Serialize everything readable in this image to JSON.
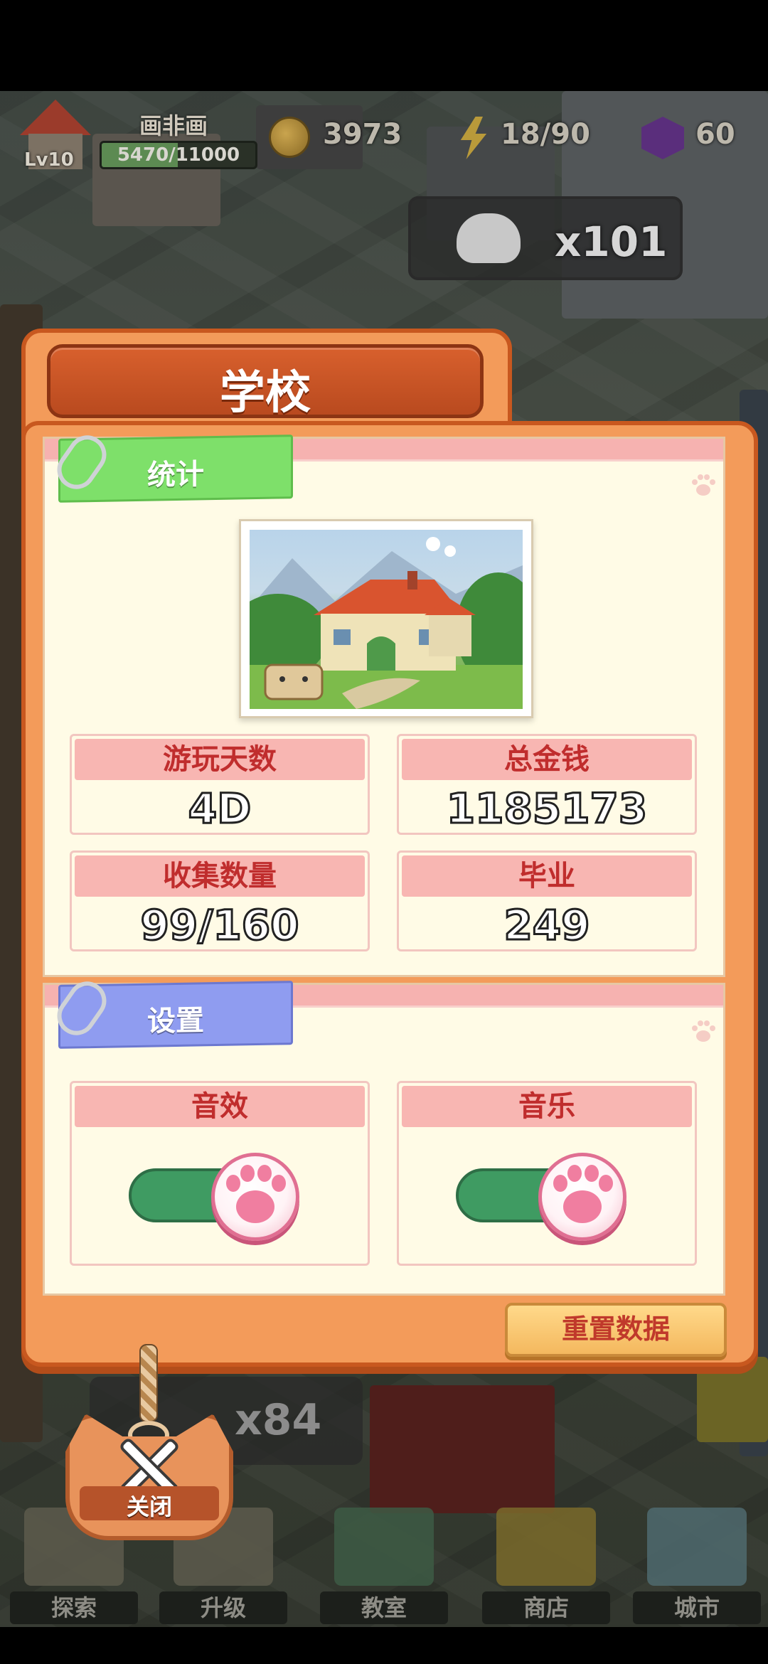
{
  "hud": {
    "level": "Lv10",
    "player_name": "画非画",
    "xp_text": "5470/11000",
    "xp_progress": 0.497,
    "coins": "3973",
    "energy": "18/90",
    "gems": "60",
    "cats_count": "x101",
    "secondary_count": "x84"
  },
  "dialog": {
    "title": "学校",
    "stats_section": {
      "label": "统计",
      "color": "#7ee06a",
      "items": [
        {
          "label": "游玩天数",
          "value": "4D"
        },
        {
          "label": "总金钱",
          "value": "1185173"
        },
        {
          "label": "收集数量",
          "value": "99/160"
        },
        {
          "label": "毕业",
          "value": "249"
        }
      ]
    },
    "settings_section": {
      "label": "设置",
      "color": "#8f9cf0",
      "toggles": [
        {
          "label": "音效",
          "state": "on"
        },
        {
          "label": "音乐",
          "state": "on"
        }
      ]
    },
    "reset_button": "重置数据",
    "close_button": "关闭"
  },
  "nav": {
    "items": [
      {
        "label": "探索",
        "icon": "map-icon"
      },
      {
        "label": "升级",
        "icon": "upgrade-icon"
      },
      {
        "label": "教室",
        "icon": "chalkboard-icon"
      },
      {
        "label": "商店",
        "icon": "dollar-icon"
      },
      {
        "label": "城市",
        "icon": "city-icon"
      }
    ]
  },
  "colors": {
    "panel_orange": "#f39b5a",
    "panel_border": "#c8581f",
    "stat_head_pink": "#f8b6b2",
    "stat_head_text": "#c02d2d",
    "toggle_green": "#3f9b62"
  }
}
